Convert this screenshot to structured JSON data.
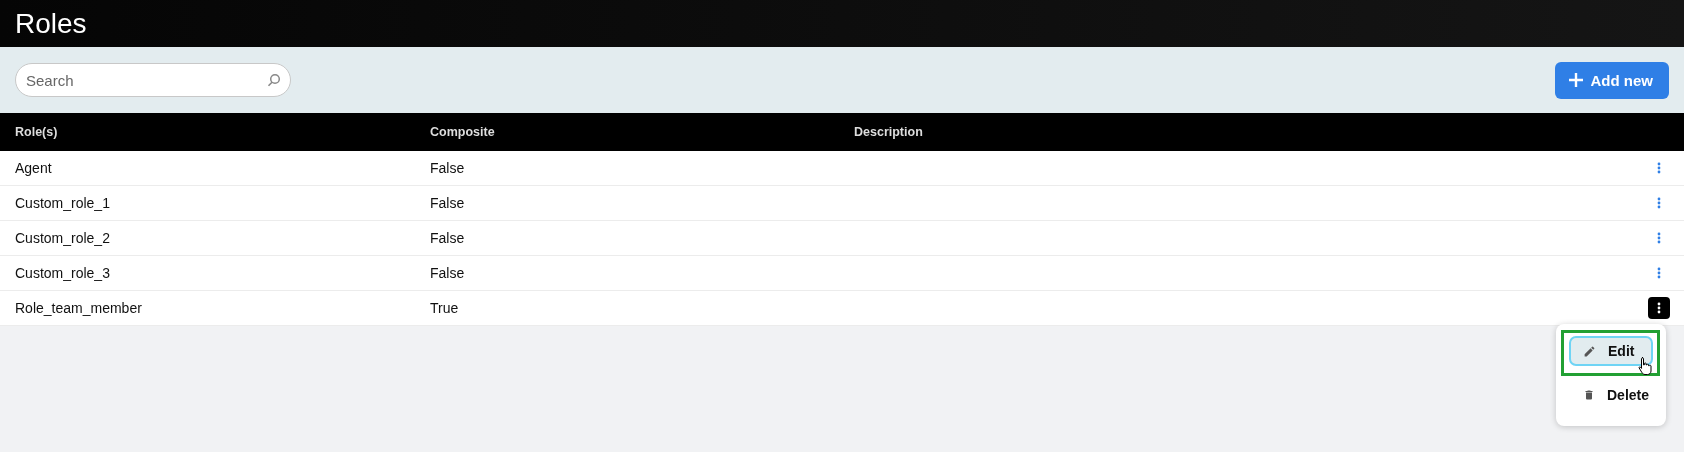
{
  "header": {
    "title": "Roles"
  },
  "toolbar": {
    "search": {
      "placeholder": "Search"
    },
    "add_button": {
      "label": "Add new"
    }
  },
  "table": {
    "columns": [
      "Role(s)",
      "Composite",
      "Description"
    ],
    "rows": [
      {
        "role": "Agent",
        "composite": "False",
        "menu_open": false
      },
      {
        "role": "Custom_role_1",
        "composite": "False",
        "menu_open": false
      },
      {
        "role": "Custom_role_2",
        "composite": "False",
        "menu_open": false
      },
      {
        "role": "Custom_role_3",
        "composite": "False",
        "menu_open": false
      },
      {
        "role": "Role_team_member",
        "composite": "True",
        "menu_open": true
      }
    ]
  },
  "row_menu": {
    "items": [
      {
        "kind": "edit",
        "label": "Edit",
        "selected": true
      },
      {
        "kind": "delete",
        "label": "Delete",
        "selected": false
      }
    ]
  }
}
